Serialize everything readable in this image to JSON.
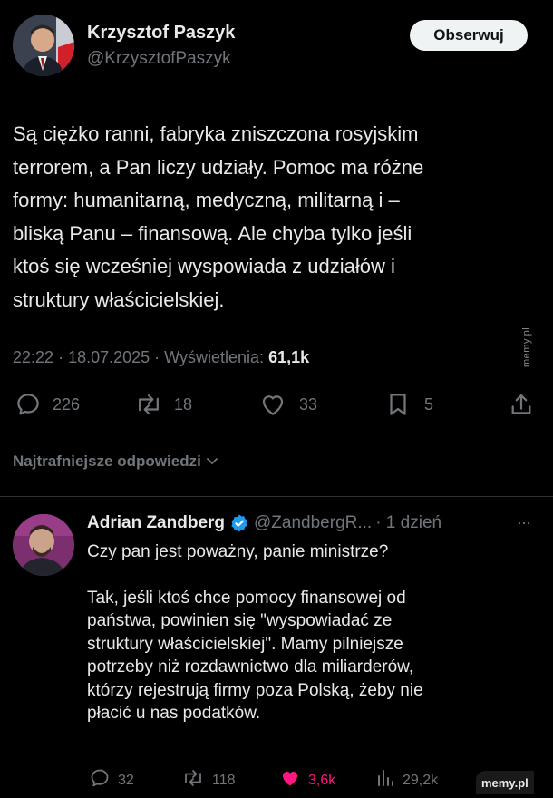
{
  "tweet": {
    "author_name": "Krzysztof Paszyk",
    "author_handle": "@KrzysztofPaszyk",
    "follow_label": "Obserwuj",
    "text_lines": [
      "Są ciężko ranni, fabryka zniszczona rosyjskim",
      "terrorem, a Pan liczy udziały. Pomoc ma różne",
      "formy: humanitarną, medyczną, militarną i –",
      "bliską Panu – finansową. Ale chyba tylko jeśli",
      "ktoś się wcześniej wyspowiada z udziałów i",
      "struktury właścicielskiej."
    ],
    "time": "22:22",
    "date": "18.07.2025",
    "views_label": "Wyświetlenia:",
    "views": "61,1k",
    "replies": "226",
    "reposts": "18",
    "likes": "33",
    "bookmarks": "5"
  },
  "replies_sort_label": "Najtrafniejsze odpowiedzi",
  "reply": {
    "author_name": "Adrian Zandberg",
    "author_handle": "@ZandbergR...",
    "age": "· 1 dzień",
    "more": "···",
    "line1": "Czy pan jest poważny, panie ministrze?",
    "paragraph_lines": [
      "Tak, jeśli ktoś chce pomocy finansowej od",
      "państwa, powinien się \"wyspowiadać ze",
      "struktury właścicielskiej\". Mamy pilniejsze",
      "potrzeby niż rozdawnictwo dla miliarderów,",
      "którzy rejestrują firmy poza Polską, żeby nie",
      "płacić u nas podatków."
    ],
    "replies": "32",
    "reposts": "118",
    "likes": "3,6k",
    "views": "29,2k"
  },
  "watermark": "memy.pl",
  "colors": {
    "background": "#000000",
    "text": "#e7e9ea",
    "secondary": "#71767b",
    "like_active": "#f91880",
    "verified": "#1d9bf0",
    "divider": "#2f3336"
  }
}
